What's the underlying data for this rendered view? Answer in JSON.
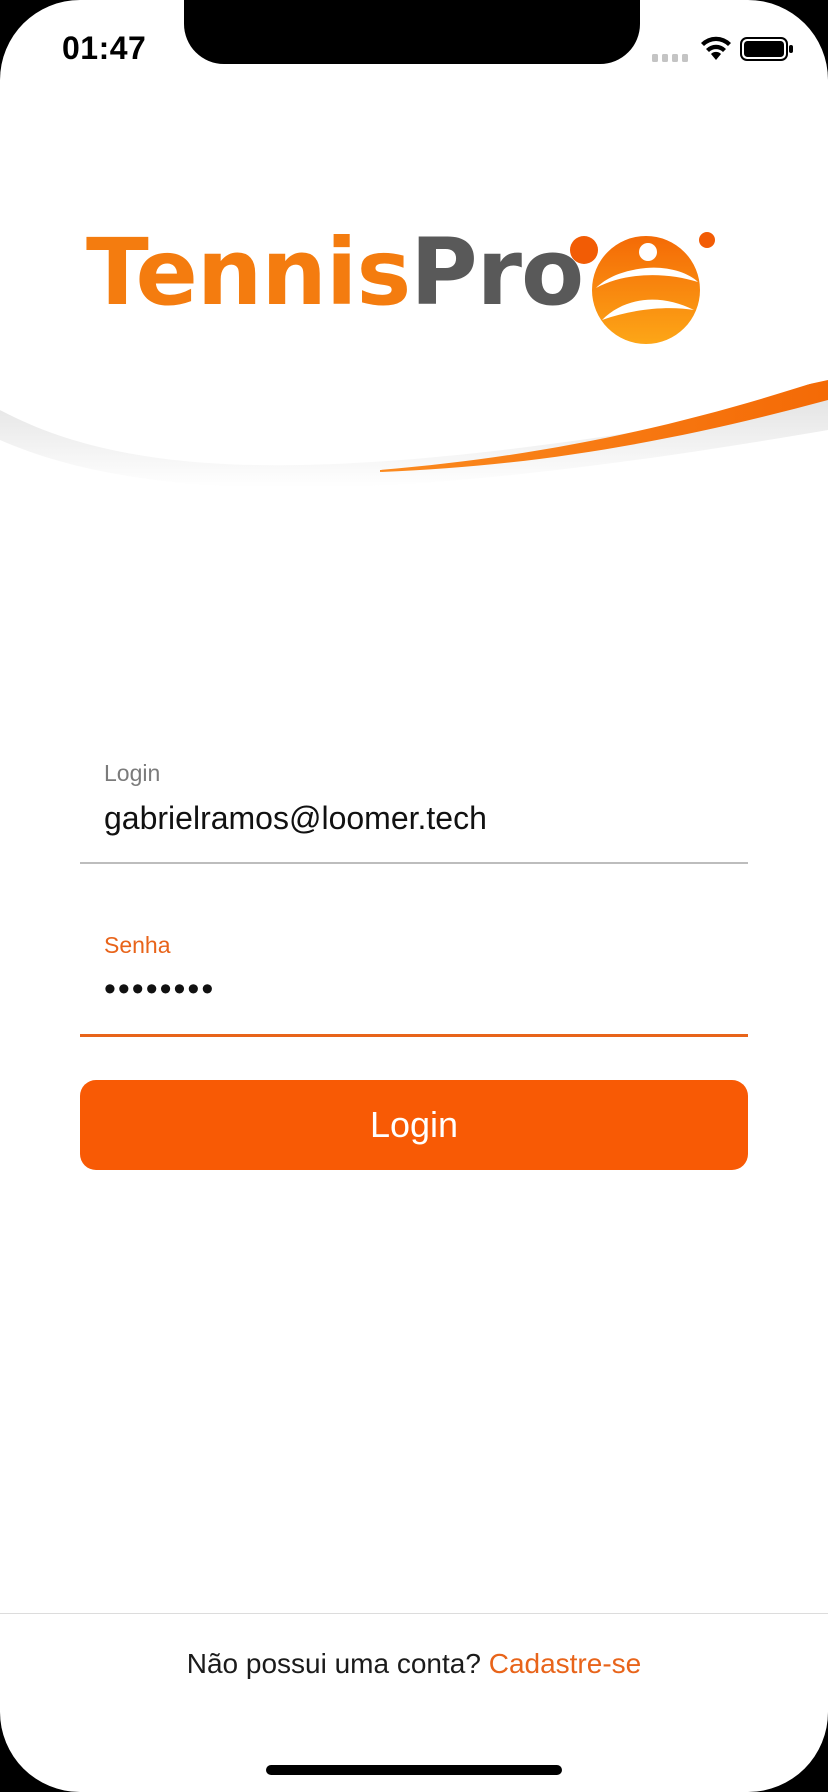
{
  "status_bar": {
    "time": "01:47"
  },
  "logo": {
    "part1": "Tennis",
    "part2": "Pro",
    "mark_icon": "tennis-player-ball-icon"
  },
  "form": {
    "login": {
      "label": "Login",
      "value": "gabrielramos@loomer.tech"
    },
    "password": {
      "label": "Senha",
      "value": "••••••••"
    },
    "submit_label": "Login"
  },
  "footer": {
    "prompt": "Não possui uma conta?",
    "signup_link": "Cadastre-se"
  },
  "colors": {
    "accent": "#f85a05",
    "brand_orange": "#f47c0f",
    "brand_gray": "#595959",
    "link": "#e8641a"
  }
}
